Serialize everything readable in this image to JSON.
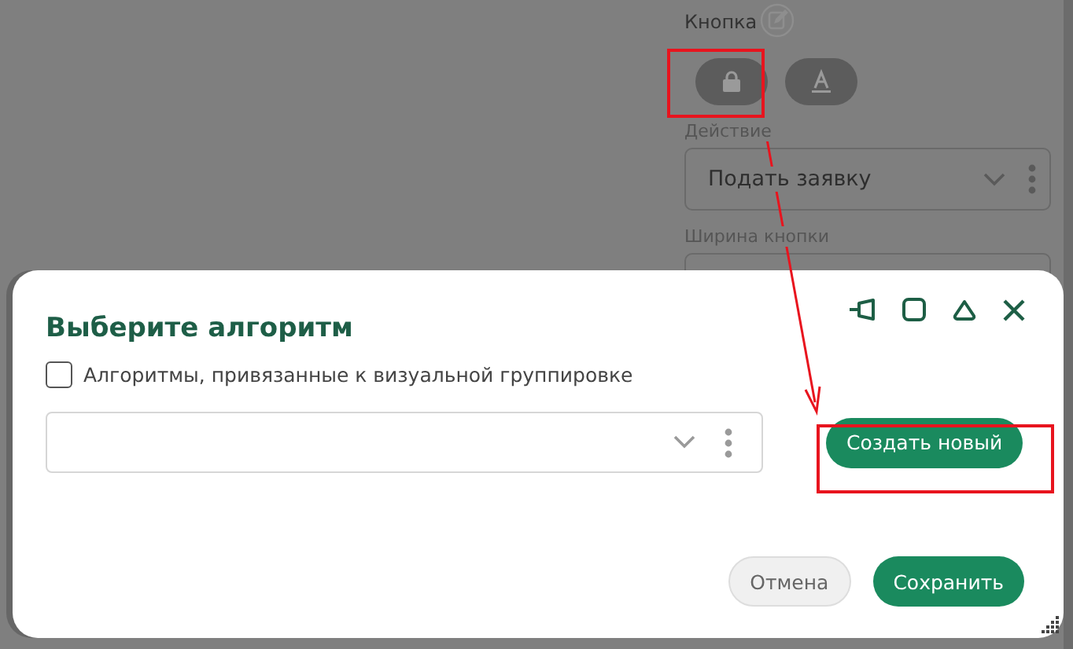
{
  "panel": {
    "title": "Кнопка",
    "action_label": "Действие",
    "action_value": "Подать заявку",
    "width_label": "Ширина кнопки"
  },
  "dialog": {
    "title": "Выберите алгоритм",
    "checkbox": {
      "label": "Алгоритмы, привязанные к визуальной группировке",
      "checked": false
    },
    "create_button": "Создать новый",
    "buttons": [
      {
        "label": "Отмена",
        "kind": "secondary"
      },
      {
        "label": "Сохранить",
        "kind": "primary"
      }
    ]
  }
}
